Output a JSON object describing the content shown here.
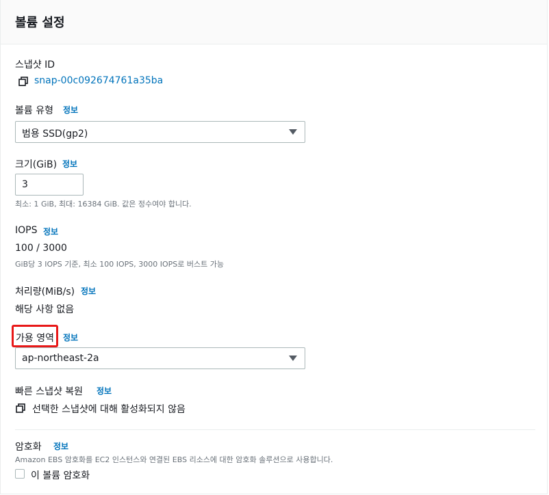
{
  "header": {
    "title": "볼륨 설정"
  },
  "snapshot": {
    "label": "스냅샷 ID",
    "id": "snap-00c092674761a35ba",
    "copy_icon": "copy-icon"
  },
  "volume_type": {
    "label": "볼륨 유형",
    "info": "정보",
    "selected": "범용 SSD(gp2)"
  },
  "size": {
    "label": "크기(GiB)",
    "info": "정보",
    "value": "3",
    "hint": "최소: 1 GiB, 최대: 16384 GiB. 값은 정수여야 합니다."
  },
  "iops": {
    "label": "IOPS",
    "info": "정보",
    "value": "100 / 3000",
    "hint": "GiB당 3 IOPS 기준, 최소 100 IOPS, 3000 IOPS로 버스트 가능"
  },
  "throughput": {
    "label": "처리량(MiB/s)",
    "info": "정보",
    "value": "해당 사항 없음"
  },
  "availability_zone": {
    "label": "가용 영역",
    "info": "정보",
    "selected": "ap-northeast-2a",
    "highlight_color": "#e81818"
  },
  "fast_restore": {
    "label": "빠른 스냅샷 복원",
    "info": "정보",
    "value": "선택한 스냅샷에 대해 활성화되지 않음"
  },
  "encryption": {
    "label": "암호화",
    "info": "정보",
    "description": "Amazon EBS 암호화를 EC2 인스턴스와 연결된 EBS 리소스에 대한 암호화 솔루션으로 사용합니다.",
    "checkbox_label": "이 볼륨 암호화",
    "checked": false
  },
  "colors": {
    "link": "#0073bb",
    "text": "#16191f",
    "hint": "#687078",
    "border": "#aab7b8"
  }
}
